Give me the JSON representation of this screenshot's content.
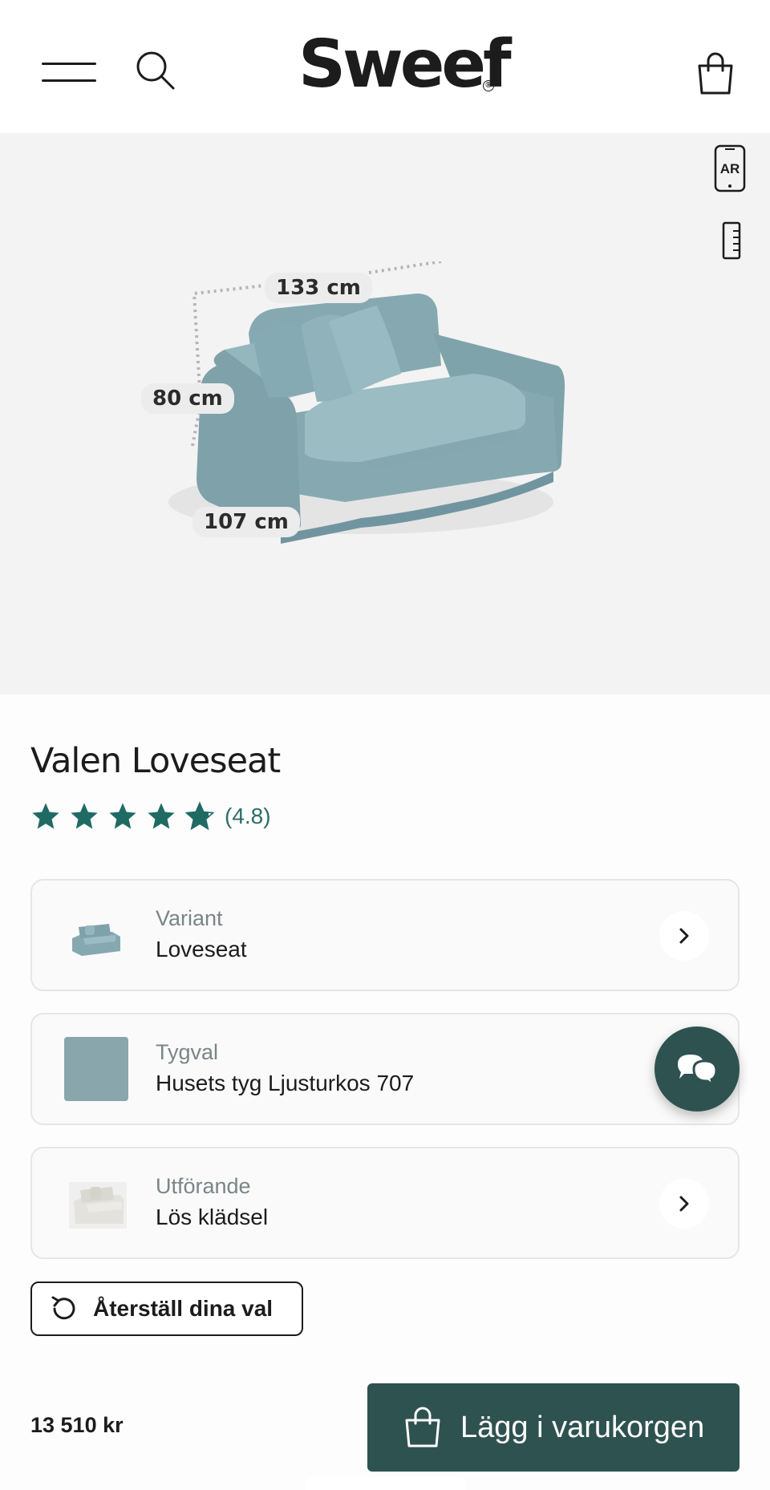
{
  "header": {
    "logo_text": "Sweef",
    "logo_mark": "®",
    "menu_icon": "hamburger-icon",
    "search_icon": "search-icon",
    "cart_icon": "shopping-bag-icon"
  },
  "viewer": {
    "ar_label": "AR",
    "dimensions": {
      "width": "133 cm",
      "height": "80 cm",
      "depth": "107 cm"
    },
    "sofa_color": "#8fb4bd"
  },
  "product": {
    "title": "Valen Loveseat",
    "rating_display": "(4.8)",
    "rating_value": 4.8,
    "rating_max": 5
  },
  "options": [
    {
      "label": "Variant",
      "value": "Loveseat",
      "thumb": "loveseat-thumbnail",
      "chevron": true
    },
    {
      "label": "Tygval",
      "value": "Husets tyg Ljusturkos 707",
      "thumb": "fabric-swatch",
      "swatch_color": "#8aa6ad",
      "chevron": false
    },
    {
      "label": "Utförande",
      "value": "Lös klädsel",
      "thumb": "loose-cover-thumbnail",
      "chevron": true
    }
  ],
  "reset": {
    "label": "Återställ dina val"
  },
  "checkout": {
    "price": "13 510 kr",
    "add_to_cart_label": "Lägg i varukorgen"
  },
  "colors": {
    "accent": "#2e5250",
    "star": "#1f6b64",
    "viewer_bg": "#f3f3f3"
  }
}
